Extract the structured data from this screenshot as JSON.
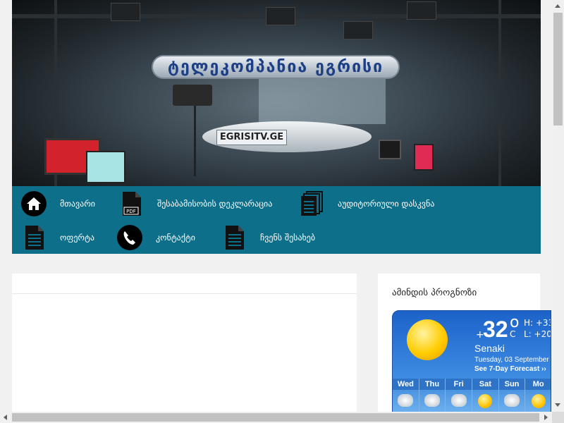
{
  "banner": {
    "logo_text": "ტელეკომპანია ეგრისი",
    "desk_sign": "EGRISITV.GE"
  },
  "nav": {
    "items": [
      {
        "label": "მთავარი",
        "icon": "home-icon"
      },
      {
        "label": "შესაბამისობის დეკლარაცია",
        "icon": "pdf-icon"
      },
      {
        "label": "აუდიტორიული დასკვნა",
        "icon": "documents-icon"
      },
      {
        "label": "ოფერტა",
        "icon": "document-icon"
      },
      {
        "label": "კონტაქტი",
        "icon": "phone-icon"
      },
      {
        "label": "ჩვენს შესახებ",
        "icon": "document-icon"
      }
    ],
    "bg_color": "#0d6f8a"
  },
  "sidebar": {
    "title": "ამინდის პროგნოზი",
    "weather": {
      "temp": "32",
      "temp_sign": "+",
      "degree_symbol": "o",
      "unit": "C",
      "high": "H: +33",
      "low": "L: +20",
      "city": "Senaki",
      "date": "Tuesday, 03 September",
      "forecast_link": "See 7-Day Forecast ››",
      "days": [
        {
          "name": "Wed",
          "icon": "cloud-icon"
        },
        {
          "name": "Thu",
          "icon": "cloud-icon"
        },
        {
          "name": "Fri",
          "icon": "cloud-icon"
        },
        {
          "name": "Sat",
          "icon": "sun-icon"
        },
        {
          "name": "Sun",
          "icon": "cloud-icon"
        },
        {
          "name": "Mo",
          "icon": "sun-icon"
        }
      ]
    }
  }
}
